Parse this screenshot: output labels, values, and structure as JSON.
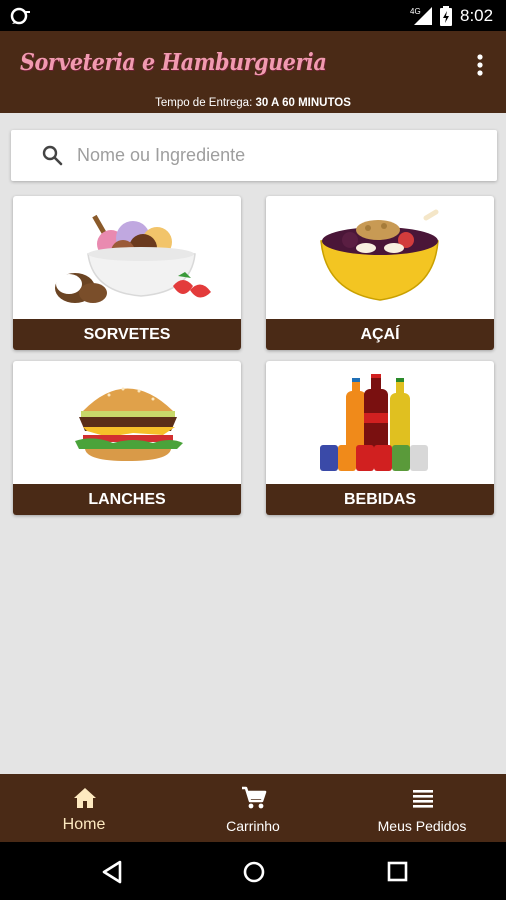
{
  "status_bar": {
    "time": "8:02",
    "network": "4G"
  },
  "app_bar": {
    "title": "Sorveteria e Hamburgueria",
    "delivery_label": "Tempo de Entrega:",
    "delivery_value": "30 A 60 MINUTOS"
  },
  "search": {
    "placeholder": "Nome ou Ingrediente",
    "value": ""
  },
  "categories": [
    {
      "label": "SORVETES"
    },
    {
      "label": "AÇAÍ"
    },
    {
      "label": "LANCHES"
    },
    {
      "label": "BEBIDAS"
    }
  ],
  "bottom_nav": [
    {
      "label": "Home",
      "icon": "home-icon",
      "active": true
    },
    {
      "label": "Carrinho",
      "icon": "cart-icon",
      "active": false
    },
    {
      "label": "Meus Pedidos",
      "icon": "list-icon",
      "active": false
    }
  ],
  "colors": {
    "brand": "#4a2a16",
    "title": "#f19ab0",
    "background": "#e4e4e4"
  }
}
